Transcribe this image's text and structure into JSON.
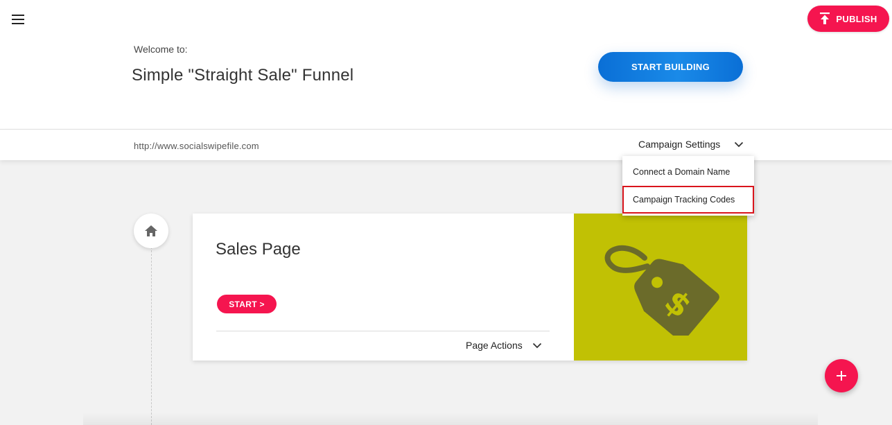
{
  "header": {
    "publish_label": "PUBLISH",
    "welcome_text": "Welcome to:",
    "funnel_title": "Simple \"Straight Sale\" Funnel",
    "start_building_label": "START BUILDING"
  },
  "settings_bar": {
    "url": "http://www.socialswipefile.com",
    "campaign_settings_label": "Campaign Settings"
  },
  "dropdown": {
    "items": [
      {
        "label": "Connect a Domain Name"
      },
      {
        "label": "Campaign Tracking Codes"
      }
    ],
    "highlighted_item": "Campaign Tracking Codes",
    "highlight_color": "#d9141c"
  },
  "page_card": {
    "title": "Sales Page",
    "start_label": "START >",
    "page_actions_label": "Page Actions",
    "image_icon": "price-tag-dollar-icon",
    "image_bg": "#c1c104"
  },
  "icons": {
    "menu": "hamburger-menu-icon",
    "publish": "upload-icon",
    "home": "home-icon",
    "fab": "plus-icon"
  },
  "colors": {
    "accent_pink": "#f5154f",
    "primary_blue": "#0a6fd6"
  }
}
